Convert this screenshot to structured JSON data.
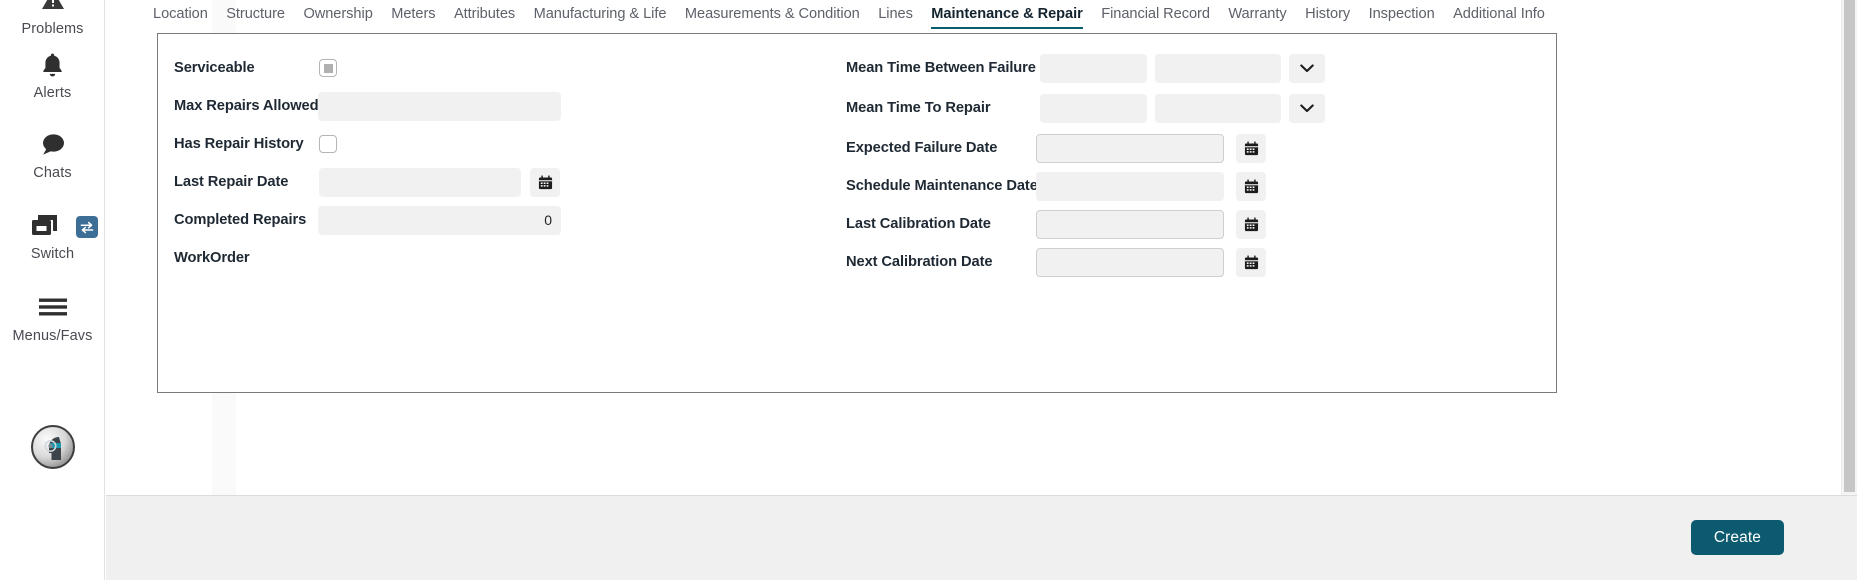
{
  "left_rail": {
    "items": [
      {
        "label": "Problems",
        "icon": "warning-icon"
      },
      {
        "label": "Alerts",
        "icon": "bell-icon"
      },
      {
        "label": "Chats",
        "icon": "chat-bubble-icon"
      },
      {
        "label": "Switch",
        "icon": "switch-windows-icon",
        "badge_icon": "swap-arrows-icon"
      },
      {
        "label": "Menus/Favs",
        "icon": "hamburger-menu-icon"
      }
    ],
    "avatar": {
      "icon": "user-avatar-icon"
    }
  },
  "tabs": [
    {
      "label": "Location",
      "active": false
    },
    {
      "label": "Structure",
      "active": false
    },
    {
      "label": "Ownership",
      "active": false
    },
    {
      "label": "Meters",
      "active": false
    },
    {
      "label": "Attributes",
      "active": false
    },
    {
      "label": "Manufacturing & Life",
      "active": false
    },
    {
      "label": "Measurements & Condition",
      "active": false
    },
    {
      "label": "Lines",
      "active": false
    },
    {
      "label": "Maintenance & Repair",
      "active": true
    },
    {
      "label": "Financial Record",
      "active": false
    },
    {
      "label": "Warranty",
      "active": false
    },
    {
      "label": "History",
      "active": false
    },
    {
      "label": "Inspection",
      "active": false
    },
    {
      "label": "Additional Info",
      "active": false
    }
  ],
  "form": {
    "left_column": [
      {
        "label": "Serviceable",
        "type": "checkbox",
        "state": "indeterminate"
      },
      {
        "label": "Max Repairs Allowed",
        "type": "text",
        "value": "",
        "placeholder": ""
      },
      {
        "label": "Has Repair History",
        "type": "checkbox",
        "state": "unchecked"
      },
      {
        "label": "Last Repair Date",
        "type": "date",
        "value": "",
        "placeholder": "",
        "button_icon": "calendar-icon"
      },
      {
        "label": "Completed Repairs",
        "type": "number",
        "value": "0",
        "placeholder": ""
      },
      {
        "label": "WorkOrder",
        "type": "label-only"
      }
    ],
    "right_column": [
      {
        "label": "Mean Time Between Failure",
        "type": "duration",
        "value_a": "",
        "value_b": "",
        "button_icon": "chevron-down-icon"
      },
      {
        "label": "Mean Time To Repair",
        "type": "duration",
        "value_a": "",
        "value_b": "",
        "button_icon": "chevron-down-icon"
      },
      {
        "label": "Expected Failure Date",
        "type": "date",
        "value": "",
        "bordered": true,
        "button_icon": "calendar-icon"
      },
      {
        "label": "Schedule Maintenance Date",
        "type": "date",
        "value": "",
        "bordered": false,
        "button_icon": "calendar-icon"
      },
      {
        "label": "Last Calibration Date",
        "type": "date",
        "value": "",
        "bordered": true,
        "button_icon": "calendar-icon"
      },
      {
        "label": "Next Calibration Date",
        "type": "date",
        "value": "",
        "bordered": true,
        "button_icon": "calendar-icon"
      }
    ]
  },
  "footer": {
    "create_label": "Create"
  },
  "colors": {
    "accent": "#0b5a70",
    "tab_underline": "#0c5d72",
    "badge": "#3d6e96",
    "input_bg": "#f1f1f1",
    "panel_border": "#7a7a7a",
    "footer_bg": "#f0f0f0"
  }
}
